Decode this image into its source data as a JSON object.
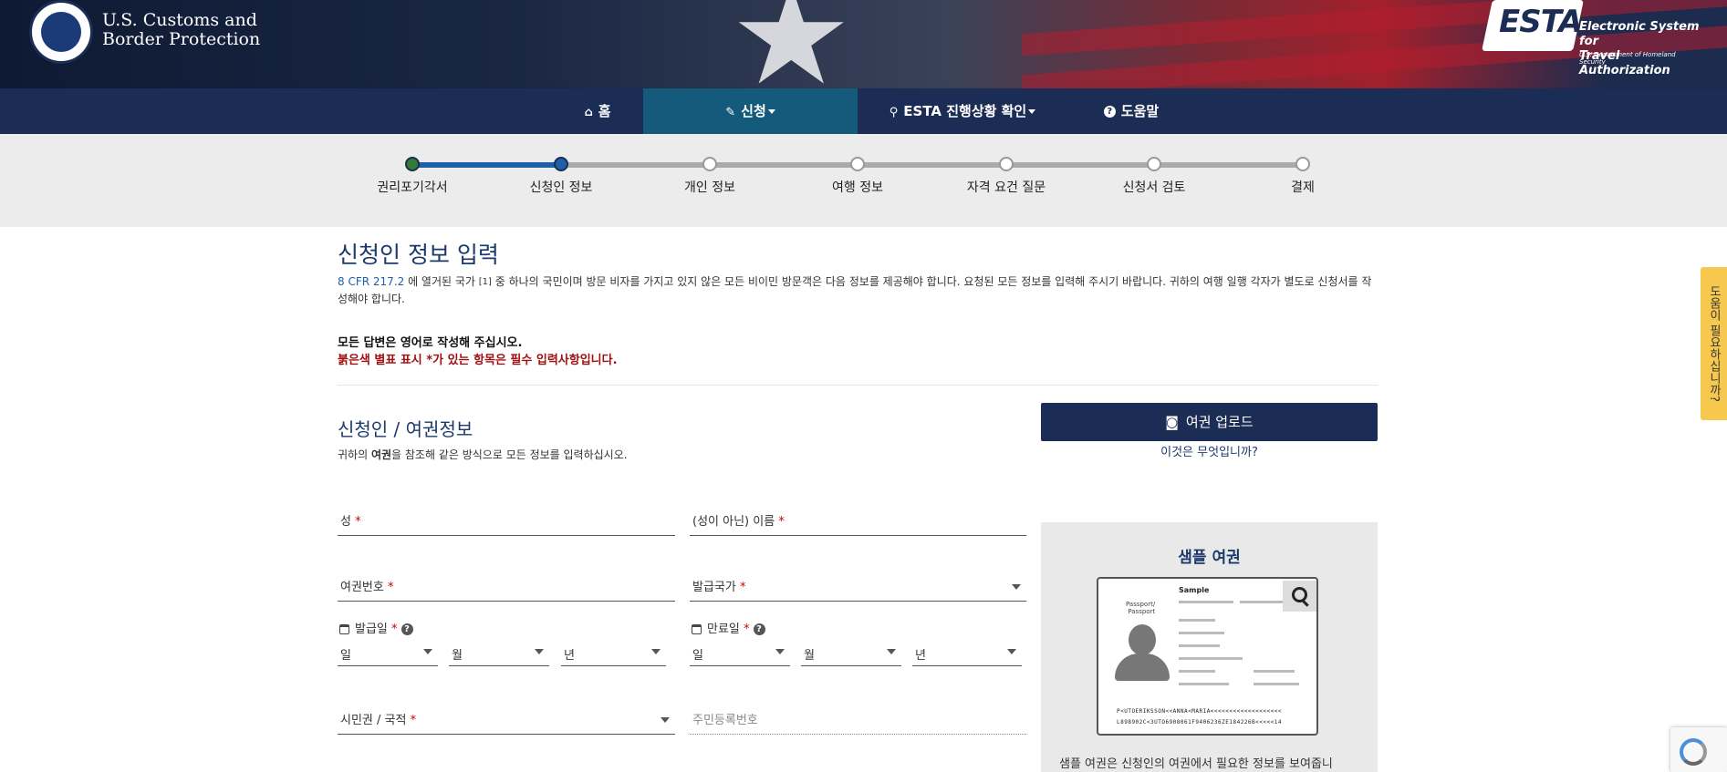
{
  "header": {
    "agency_line1": "U.S. Customs and",
    "agency_line2": "Border Protection",
    "esta_logo_text": "ESTA",
    "esta_side_line1": "Electronic System for",
    "esta_side_line2": "Travel Authorization",
    "esta_sub": "U.S. Department of Homeland Security"
  },
  "nav": {
    "items": [
      {
        "icon": "home-icon",
        "label": "홈"
      },
      {
        "icon": "pencil-icon",
        "label": "신청"
      },
      {
        "icon": "search-icon",
        "label": "ESTA 진행상황 확인"
      },
      {
        "icon": "question-icon",
        "label": "도움말"
      }
    ]
  },
  "progress": {
    "steps": [
      "권리포기각서",
      "신청인 정보",
      "개인 정보",
      "여행 정보",
      "자격 요건 질문",
      "신청서 검토",
      "결제"
    ],
    "current_step": 2
  },
  "page": {
    "title": "신청인 정보 입력",
    "intro_link": "8 CFR 217.2",
    "intro_text_a": " 에 열거된 국가 ",
    "intro_footnote": "[1]",
    "intro_text_b": " 중 하나의 국민이며 방문 비자를 가지고 있지 않은 모든 비이민 방문객은 다음 정보를 제공해야 합니다. 요청된 모든 정보를 입력해 주시기 바랍니다. 귀하의 여행 일행 각자가 별도로 신청서를 작성해야 합니다.",
    "note_english": "모든 답변은 영어로 작성해 주십시오.",
    "note_required": "붉은색 별표 표시 *가 있는 항목은 필수 입력사항입니다."
  },
  "section": {
    "title": "신청인 / 여권정보",
    "subtitle_a": "귀하의 ",
    "subtitle_bold": "여권",
    "subtitle_b": "을 참조해 같은 방식으로 모든 정보를 입력하십시오.",
    "upload_button": "여권 업로드",
    "what_is_this": "이것은 무엇입니까?"
  },
  "form": {
    "surname": "성",
    "given_name": "(성이 아닌) 이름",
    "passport_number": "여권번호",
    "issuing_country": "발급국가",
    "issue_date": "발급일",
    "expiry_date": "만료일",
    "day": "일",
    "month": "월",
    "year": "년",
    "citizenship": "시민권 / 국적",
    "national_id": "주민등록번호",
    "required_mark": "*",
    "help_mark": "?"
  },
  "sample": {
    "title": "샘플 여권",
    "card_header": "Sample",
    "card_kind1": "Passport/",
    "card_kind2": "Passport",
    "mrz1": "P<UTOERIKSSON<<ANNA<MARIA<<<<<<<<<<<<<<<<<<<",
    "mrz2": "L898902C<3UTO6908061F9406236ZE184226B<<<<<14",
    "description": "샘플 여권은 신청인의 여권에서 필요한 정보를 보여줍니"
  },
  "side_help": "도움이 필요하십니까?"
}
